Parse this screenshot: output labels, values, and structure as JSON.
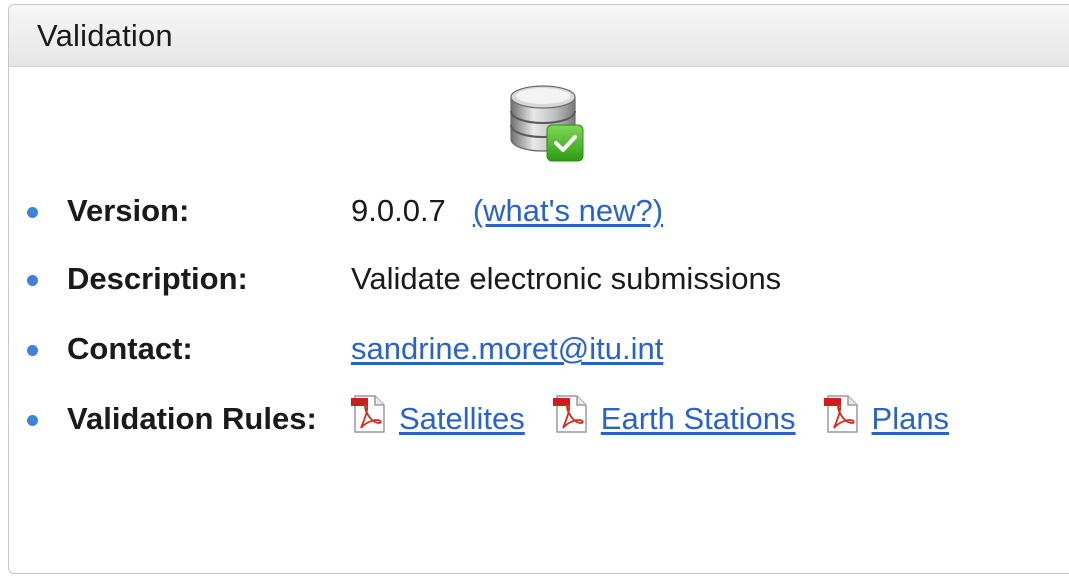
{
  "panel": {
    "title": "Validation"
  },
  "icons": {
    "header_icon": "database-check-icon",
    "rule_icon": "pdf-document-icon"
  },
  "rows": {
    "version": {
      "label": "Version:",
      "value": "9.0.0.7",
      "link": "(what's new?)"
    },
    "description": {
      "label": "Description:",
      "value": "Validate electronic submissions"
    },
    "contact": {
      "label": "Contact:",
      "email": "sandrine.moret@itu.int"
    },
    "rules": {
      "label": "Validation Rules:",
      "items": [
        "Satellites",
        "Earth Stations",
        "Plans"
      ]
    }
  },
  "colors": {
    "bullet": "#3f82d7",
    "link": "#2a63c8",
    "header_bg": "#ececec",
    "check_green": "#4caf1f"
  }
}
